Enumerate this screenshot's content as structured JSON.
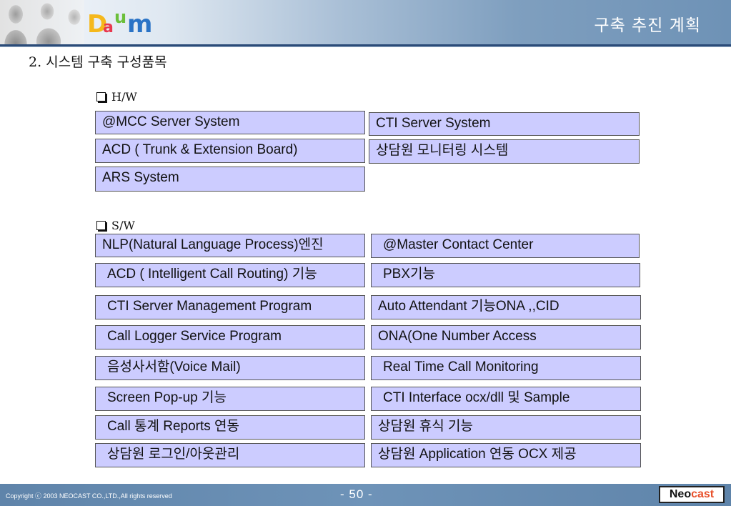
{
  "header": {
    "logo": "Daum",
    "title": "구축 추진 계획"
  },
  "section_title": "2. 시스템 구축 구성품목",
  "hw": {
    "heading": "H/W",
    "items": [
      "@MCC Server System",
      "CTI Server System",
      "ACD ( Trunk & Extension Board)",
      "상담원 모니터링 시스템",
      "ARS System"
    ]
  },
  "sw": {
    "heading": "S/W",
    "items": [
      "NLP(Natural Language Process)엔진",
      "@Master Contact Center",
      "ACD ( Intelligent Call Routing) 기능",
      "PBX기능",
      "CTI Server Management Program",
      "Auto Attendant 기능ONA ,,CID",
      "Call Logger Service Program",
      "ONA(One Number Access",
      "음성사서함(Voice Mail)",
      "Real Time Call Monitoring",
      "Screen Pop-up 기능",
      "CTI Interface ocx/dll 및 Sample",
      "Call 통계 Reports 연동",
      "상담원 휴식 기능",
      "상담원 로그인/아웃관리",
      "상담원 Application 연동 OCX 제공"
    ]
  },
  "footer": {
    "copyright": "Copyright ⓒ 2003 NEOCAST CO.,LTD.,All rights reserved",
    "page_number": "- 50 -",
    "brand_part1": "Neo",
    "brand_part2": "cast"
  }
}
